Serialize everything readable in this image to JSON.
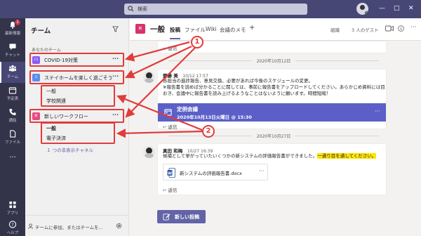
{
  "topbar": {
    "search_placeholder": "検索",
    "window_controls": [
      "—",
      "□",
      "✕"
    ]
  },
  "rail": {
    "items": [
      {
        "label": "最新情報",
        "icon": "bell-icon",
        "badge": "1"
      },
      {
        "label": "チャット",
        "icon": "chat-icon"
      },
      {
        "label": "チーム",
        "icon": "teams-icon"
      },
      {
        "label": "予定表",
        "icon": "calendar-icon"
      },
      {
        "label": "通話",
        "icon": "phone-icon"
      },
      {
        "label": "ファイル",
        "icon": "file-icon"
      },
      {
        "label": "...",
        "icon": "more-icon"
      },
      {
        "label": "アプリ",
        "icon": "apps-icon"
      },
      {
        "label": "ヘルプ",
        "icon": "help-icon"
      }
    ]
  },
  "panel": {
    "title": "チーム",
    "section_label": "あなたのチーム",
    "teams": [
      {
        "tile": "C1",
        "name": "COVID-19対策",
        "color": "#8b5cf6",
        "channels": []
      },
      {
        "tile": "ス",
        "name": "ステイホームを楽しく過ごそう",
        "color": "#5b8def",
        "channels": [
          "一般",
          "学校関連"
        ]
      },
      {
        "tile": "新",
        "name": "新しいワークフロー",
        "color": "#e64980",
        "channels": [
          "一般",
          "電子決済"
        ],
        "hidden": "１ つの非表示チャネル"
      }
    ],
    "bottom_text": "チームに参加、またはチームを..."
  },
  "header": {
    "tile": "新",
    "channel_name": "一般",
    "tabs": [
      "投稿",
      "ファイル",
      "Wiki",
      "会議のメモ"
    ],
    "plus": "+",
    "org_label": "組織",
    "guests_label": "3 人のゲスト"
  },
  "messages": {
    "reply_label": "返信",
    "date1": "2020年10月12日",
    "msg1": {
      "author": "齋藤 美",
      "time": "10/12 17:57",
      "lines": [
        "各担当の進捗報告、意見交換、必要があれば今後のスケジュールの変更。",
        "※報告書を読めば分かることに関しては、事前に報告書をアップロードしてください。あらかじめ資料には目を通して",
        "おき、会議中に報告書を読み上げるようなことはないように願います。時間短縮！"
      ]
    },
    "meeting": {
      "title": "定例会議",
      "datetime": "2020年10月13日火曜日 @ 15:30"
    },
    "date2": "2020年10月27日",
    "msg2": {
      "author": "真田 和梅",
      "time": "10/27 16:39",
      "text_before": "候補として挙がっていたいくつかの新システムの評価報告書ができました。",
      "text_highlight": "一通り目を通してください。",
      "doc": "新システムの評価報告書.docx"
    },
    "new_post": "新しい投稿"
  },
  "callouts": [
    "1",
    "2"
  ],
  "colors": {
    "accent": "#6264a7",
    "annotation": "#e23b3b",
    "topbar": "#464775",
    "rail": "#33344a"
  }
}
